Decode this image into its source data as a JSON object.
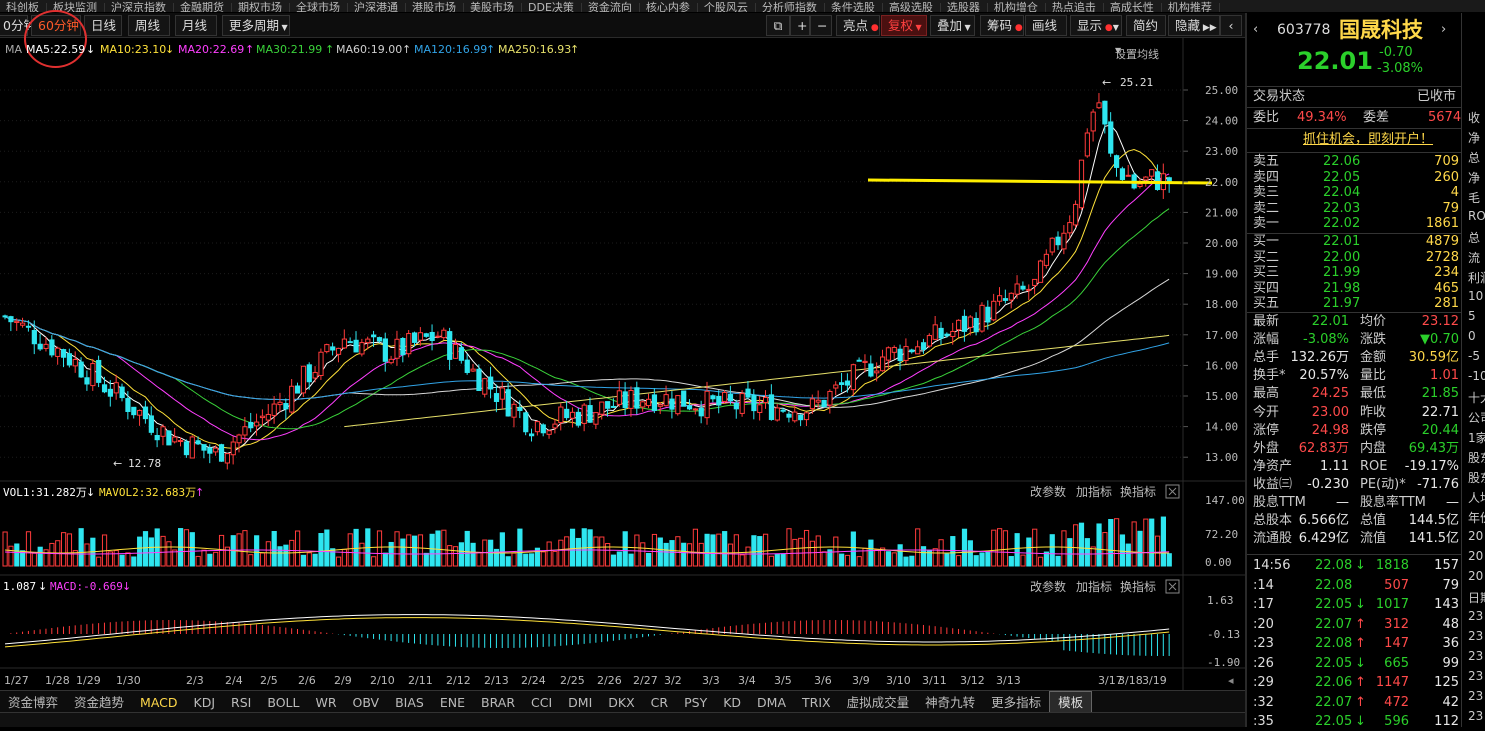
{
  "top_menu": [
    "科创板",
    "板块监测",
    "沪深京指数",
    "金融期货",
    "期权市场",
    "全球市场",
    "沪深港通",
    "港股市场",
    "美股市场",
    "DDE决策",
    "资金流向",
    "核心内参",
    "个股风云",
    "分析师指数",
    "条件选股",
    "高级选股",
    "选股器",
    "机构增仓",
    "热点追击",
    "高成长性",
    "机构推荐"
  ],
  "toolbar": {
    "period_min": "0分钟",
    "period_60": "60分钟",
    "daily": "日线",
    "weekly": "周线",
    "monthly": "月线",
    "more_periods": "更多周期",
    "highlight": "亮点",
    "restore": "复权",
    "overlay": "叠加",
    "chips": "筹码",
    "draw": "画线",
    "display": "显示",
    "simple": "简约",
    "hide": "隐藏"
  },
  "ma_legend": {
    "prefix": "MA",
    "ma5": "MA5:22.59",
    "ma10": "MA10:23.10",
    "ma20": "MA20:22.69",
    "ma30": "MA30:21.99",
    "ma60": "MA60:19.00",
    "ma120": "MA120:16.99",
    "ma250": "MA250:16.93",
    "settings": "设置均线"
  },
  "price_axis": [
    "25.00",
    "24.00",
    "23.00",
    "22.00",
    "21.00",
    "20.00",
    "19.00",
    "18.00",
    "17.00",
    "16.00",
    "15.00",
    "14.00",
    "13.00"
  ],
  "annotations": {
    "high": "25.21",
    "low": "12.78"
  },
  "volume": {
    "legend_vol": "VOL1:31.282万",
    "legend_mavol": "MAVOL2:32.683万",
    "axis": [
      "147.00",
      "72.20",
      "0.00"
    ],
    "buttons": [
      "改参数",
      "加指标",
      "换指标"
    ]
  },
  "macd": {
    "legend_dif": "1.087",
    "legend_macd": "MACD:-0.669",
    "axis": [
      "1.63",
      "-0.13",
      "-1.90"
    ],
    "buttons": [
      "改参数",
      "加指标",
      "换指标"
    ]
  },
  "date_axis": [
    "1/27",
    "1/28",
    "1/29",
    "1/30",
    "2/3",
    "2/4",
    "2/5",
    "2/6",
    "2/9",
    "2/10",
    "2/11",
    "2/12",
    "2/13",
    "2/24",
    "2/25",
    "2/26",
    "2/27",
    "3/2",
    "3/3",
    "3/4",
    "3/5",
    "3/6",
    "3/9",
    "3/10",
    "3/11",
    "3/12",
    "3/13",
    "3/17",
    "3/18",
    "3/19"
  ],
  "indicator_tabs": [
    "资金博弈",
    "资金趋势",
    "MACD",
    "KDJ",
    "RSI",
    "BOLL",
    "WR",
    "OBV",
    "BIAS",
    "ENE",
    "BRAR",
    "CCI",
    "DMI",
    "DKX",
    "CR",
    "PSY",
    "KD",
    "DMA",
    "TRIX",
    "虚拟成交量",
    "神奇九转",
    "更多指标",
    "模板"
  ],
  "quote": {
    "code": "603778",
    "name": "国晟科技",
    "price": "22.01",
    "change": "-0.70",
    "change_pct": "-3.08%",
    "side_btn": "自",
    "status_label": "交易状态",
    "status_value": "已收市",
    "weibi_label": "委比",
    "weibi": "49.34%",
    "weicha_label": "委差",
    "weicha": "5674",
    "promo": "抓住机会，即刻开户！",
    "asks": [
      {
        "label": "卖五",
        "price": "22.06",
        "vol": "709"
      },
      {
        "label": "卖四",
        "price": "22.05",
        "vol": "260"
      },
      {
        "label": "卖三",
        "price": "22.04",
        "vol": "4"
      },
      {
        "label": "卖二",
        "price": "22.03",
        "vol": "79"
      },
      {
        "label": "卖一",
        "price": "22.02",
        "vol": "1861"
      }
    ],
    "bids": [
      {
        "label": "买一",
        "price": "22.01",
        "vol": "4879"
      },
      {
        "label": "买二",
        "price": "22.00",
        "vol": "2728"
      },
      {
        "label": "买三",
        "price": "21.99",
        "vol": "234"
      },
      {
        "label": "买四",
        "price": "21.98",
        "vol": "465"
      },
      {
        "label": "买五",
        "price": "21.97",
        "vol": "281"
      }
    ],
    "stats": [
      {
        "l1": "最新",
        "v1": "22.01",
        "l2": "均价",
        "v2": "23.12"
      },
      {
        "l1": "涨幅",
        "v1": "-3.08%",
        "l2": "涨跌",
        "v2": "▼0.70"
      },
      {
        "l1": "总手",
        "v1": "132.26万",
        "l2": "金额",
        "v2": "30.59亿"
      },
      {
        "l1": "换手*",
        "v1": "20.57%",
        "l2": "量比",
        "v2": "1.01"
      },
      {
        "l1": "最高",
        "v1": "24.25",
        "l2": "最低",
        "v2": "21.85"
      },
      {
        "l1": "今开",
        "v1": "23.00",
        "l2": "昨收",
        "v2": "22.71"
      },
      {
        "l1": "涨停",
        "v1": "24.98",
        "l2": "跌停",
        "v2": "20.44"
      },
      {
        "l1": "外盘",
        "v1": "62.83万",
        "l2": "内盘",
        "v2": "69.43万"
      },
      {
        "l1": "净资产",
        "v1": "1.11",
        "l2": "ROE",
        "v2": "-19.17%"
      },
      {
        "l1": "收益㈢",
        "v1": "-0.230",
        "l2": "PE(动)*",
        "v2": "-71.76"
      },
      {
        "l1": "股息TTM",
        "v1": "—",
        "l2": "股息率TTM",
        "v2": "—"
      },
      {
        "l1": "总股本",
        "v1": "6.566亿",
        "l2": "总值",
        "v2": "144.5亿"
      },
      {
        "l1": "流通股",
        "v1": "6.429亿",
        "l2": "流值",
        "v2": "141.5亿"
      }
    ],
    "ticks": [
      {
        "time": "14:56",
        "price": "22.08",
        "arrow": "↓",
        "vol": "1818",
        "n": "157"
      },
      {
        "time": ":14",
        "price": "22.08",
        "arrow": "",
        "vol": "507",
        "n": "79"
      },
      {
        "time": ":17",
        "price": "22.05",
        "arrow": "↓",
        "vol": "1017",
        "n": "143"
      },
      {
        "time": ":20",
        "price": "22.07",
        "arrow": "↑",
        "vol": "312",
        "n": "48"
      },
      {
        "time": ":23",
        "price": "22.08",
        "arrow": "↑",
        "vol": "147",
        "n": "36"
      },
      {
        "time": ":26",
        "price": "22.05",
        "arrow": "↓",
        "vol": "665",
        "n": "99"
      },
      {
        "time": ":29",
        "price": "22.06",
        "arrow": "↑",
        "vol": "1147",
        "n": "125"
      },
      {
        "time": ":32",
        "price": "22.07",
        "arrow": "↑",
        "vol": "472",
        "n": "42"
      },
      {
        "time": ":35",
        "price": "22.05",
        "arrow": "↓",
        "vol": "596",
        "n": "112"
      }
    ]
  },
  "right_edge": [
    "收",
    "净",
    "总",
    "净",
    "毛",
    "ROE",
    "总",
    "流",
    "利润",
    "10",
    "5",
    "0",
    "-5",
    "-10",
    "十大",
    "公司",
    "1家",
    "股东",
    "股东",
    "人均",
    "年份",
    "20",
    "20",
    "20",
    "日期",
    "23",
    "23",
    "23",
    "23",
    "23",
    "23"
  ]
}
